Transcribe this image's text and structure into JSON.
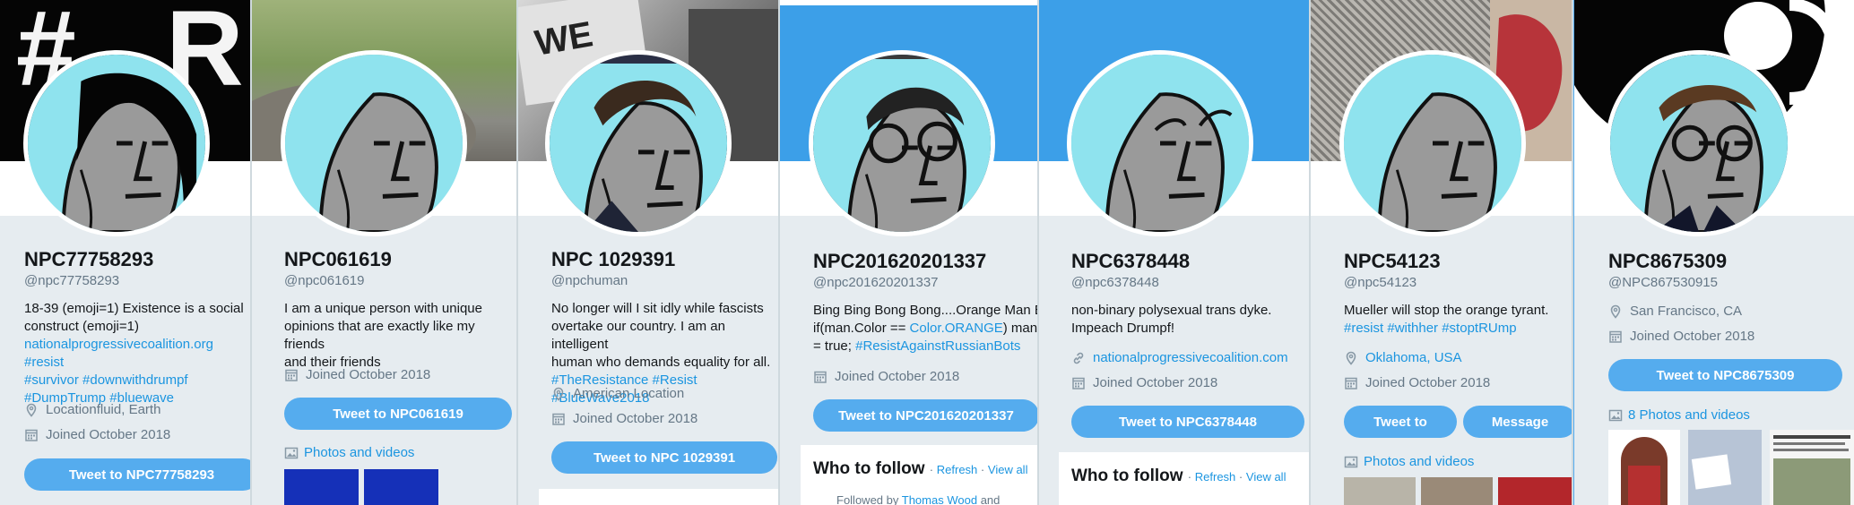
{
  "colors": {
    "accent": "#55acee",
    "link": "#1b95e0",
    "muted": "#657786",
    "banner_blue": "#3c9fe8"
  },
  "profiles": [
    {
      "name": "NPC77758293",
      "handle": "@npc77758293",
      "bio_lines": [
        "18-39 (emoji=1) Existence is a social",
        "construct (emoji=1)"
      ],
      "bio_links": [
        "nationalprogressivecoalition.org #resist",
        "#survivor #downwithdrumpf",
        "#DumpTrump #bluewave"
      ],
      "location": "Locationfluid, Earth",
      "joined": "Joined October 2018",
      "tweet_button": "Tweet to NPC77758293"
    },
    {
      "name": "NPC061619",
      "handle": "@npc061619",
      "bio_lines": [
        "I am a unique person with unique",
        "opinions that are exactly like my friends",
        "and their friends"
      ],
      "joined": "Joined October 2018",
      "tweet_button": "Tweet to NPC061619",
      "photos_link": "Photos and videos"
    },
    {
      "name": "NPC 1029391",
      "handle": "@npchuman",
      "bio_lines": [
        "No longer will I sit idly while fascists",
        "overtake our country. I am an intelligent",
        "human who demands equality for all."
      ],
      "bio_links": [
        "#TheResistance #Resist #BlueWave2018"
      ],
      "location": "American Location",
      "joined": "Joined October 2018",
      "tweet_button": "Tweet to NPC 1029391"
    },
    {
      "name": "NPC201620201337",
      "handle": "@npc201620201337",
      "bio_line1": "Bing Bing Bong Bong....Orange Man Bad",
      "bio_line2_a": "if(man.Color == ",
      "bio_line2_link": "Color.ORANGE",
      "bio_line2_b": ") man.Bad",
      "bio_line3_a": "= true; ",
      "bio_line3_link": "#ResistAgainstRussianBots",
      "joined": "Joined October 2018",
      "tweet_button": "Tweet to NPC201620201337",
      "wtf_title": "Who to follow",
      "wtf_refresh": "Refresh",
      "wtf_viewall": "View all",
      "followed_by": "Followed by",
      "followed_name": "Thomas Wood",
      "followed_and": "and"
    },
    {
      "name": "NPC6378448",
      "handle": "@npc6378448",
      "bio_lines": [
        "non-binary polysexual trans dyke.",
        "Impeach Drumpf!"
      ],
      "website": "nationalprogressivecoalition.com",
      "joined": "Joined October 2018",
      "tweet_button": "Tweet to NPC6378448",
      "wtf_title": "Who to follow",
      "wtf_refresh": "Refresh",
      "wtf_viewall": "View all"
    },
    {
      "name": "NPC54123",
      "handle": "@npc54123",
      "bio_lines": [
        "Mueller will stop the orange tyrant."
      ],
      "bio_links": [
        "#resist #withher #stoptRUmp"
      ],
      "location": "Oklahoma, USA",
      "joined": "Joined October 2018",
      "tweet_button": "Tweet to",
      "message_button": "Message",
      "photos_link": "Photos and videos"
    },
    {
      "name": "NPC8675309",
      "handle": "@NPC867530915",
      "location": "San Francisco, CA",
      "joined": "Joined October 2018",
      "tweet_button": "Tweet to NPC8675309",
      "photos_link": "8 Photos and videos"
    }
  ]
}
